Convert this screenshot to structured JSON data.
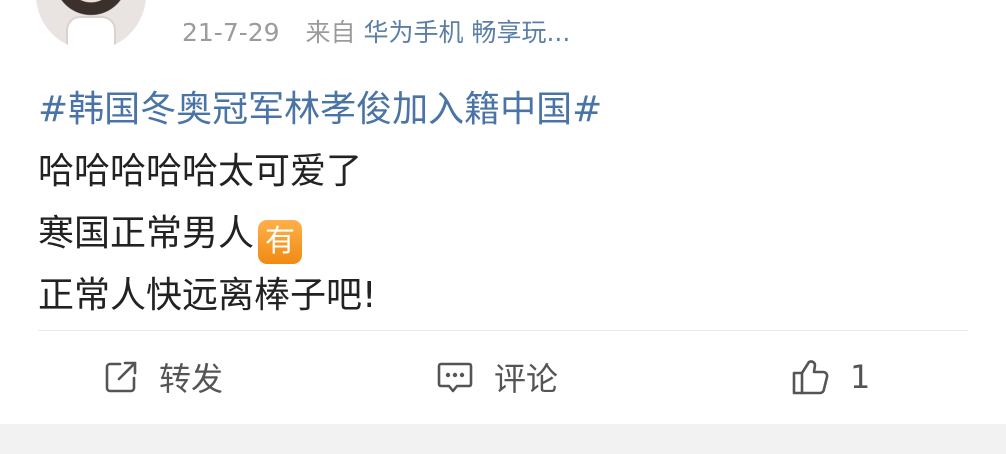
{
  "post": {
    "time": "21-7-29",
    "from_label": "来自",
    "source": "华为手机 畅享玩...",
    "topic": "#韩国冬奥冠军林孝俊加入籍中国#",
    "lines": [
      "哈哈哈哈哈太可爱了",
      "寒国正常男人",
      "正常人快远离棒子吧!"
    ],
    "emoji_text": "有"
  },
  "actions": {
    "repost_label": "转发",
    "comment_label": "评论",
    "like_count": "1"
  },
  "colors": {
    "topic_link": "#4a74a5",
    "source_link": "#5b7fa6",
    "meta_gray": "#9b9b9b",
    "emoji_orange": "#f5a12a"
  },
  "icons": [
    "repost-icon",
    "comment-icon",
    "thumbs-up-icon"
  ]
}
